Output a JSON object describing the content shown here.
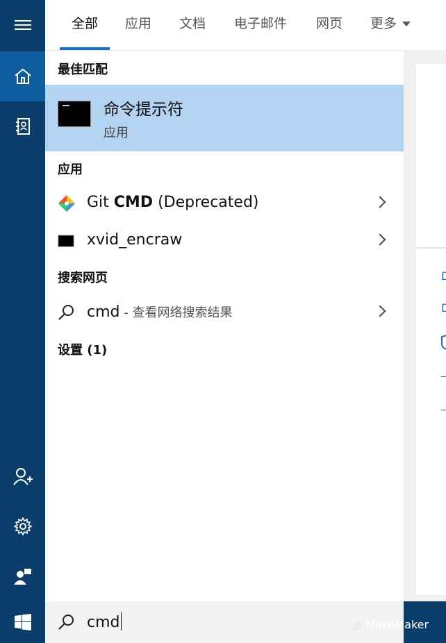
{
  "tabs": [
    {
      "label": "全部",
      "active": true
    },
    {
      "label": "应用"
    },
    {
      "label": "文档"
    },
    {
      "label": "电子邮件"
    },
    {
      "label": "网页"
    },
    {
      "label": "更多"
    }
  ],
  "sections": {
    "best_match": "最佳匹配",
    "apps": "应用",
    "web": "搜索网页",
    "settings": "设置 (1)"
  },
  "best_match": {
    "title": "命令提示符",
    "subtitle": "应用"
  },
  "apps": [
    {
      "prefix": "Git ",
      "bold": "CMD",
      "suffix": " (Deprecated)",
      "icon": "git-icon"
    },
    {
      "prefix": "xvid_encraw",
      "bold": "",
      "suffix": "",
      "icon": "console-app-icon"
    }
  ],
  "web_result": {
    "query": "cmd",
    "hint": " - 查看网络搜索结果"
  },
  "search": {
    "value": "cmd"
  },
  "watermark": "MakeMaker",
  "peek_marks": [
    "D",
    "D",
    "",
    "_",
    "_"
  ],
  "colors": {
    "rail": "#0a3d69",
    "rail_active": "#0f5d9e",
    "highlight": "#b3d4f0",
    "accent": "#1a73c8"
  },
  "rail_icons": [
    "hamburger-icon",
    "home-icon",
    "notebook-icon",
    "person-add-icon",
    "settings-icon",
    "feedback-icon",
    "windows-logo-icon"
  ]
}
